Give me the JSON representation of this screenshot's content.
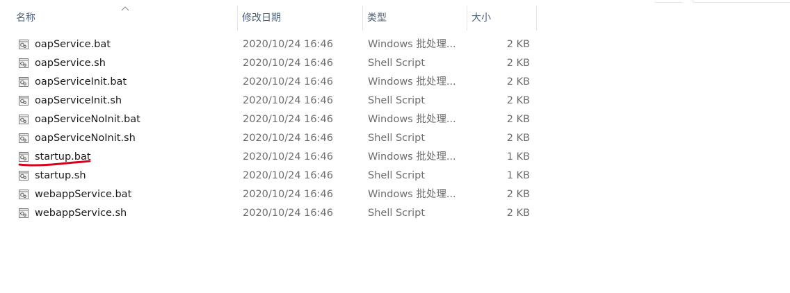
{
  "columns": {
    "name": "名称",
    "date": "修改日期",
    "type": "类型",
    "size": "大小"
  },
  "sort_indicator": "ascending",
  "files": [
    {
      "name": "oapService.bat",
      "date": "2020/10/24 16:46",
      "type": "Windows 批处理...",
      "size": "2 KB"
    },
    {
      "name": "oapService.sh",
      "date": "2020/10/24 16:46",
      "type": "Shell Script",
      "size": "2 KB"
    },
    {
      "name": "oapServiceInit.bat",
      "date": "2020/10/24 16:46",
      "type": "Windows 批处理...",
      "size": "2 KB"
    },
    {
      "name": "oapServiceInit.sh",
      "date": "2020/10/24 16:46",
      "type": "Shell Script",
      "size": "2 KB"
    },
    {
      "name": "oapServiceNoInit.bat",
      "date": "2020/10/24 16:46",
      "type": "Windows 批处理...",
      "size": "2 KB"
    },
    {
      "name": "oapServiceNoInit.sh",
      "date": "2020/10/24 16:46",
      "type": "Shell Script",
      "size": "2 KB"
    },
    {
      "name": "startup.bat",
      "date": "2020/10/24 16:46",
      "type": "Windows 批处理...",
      "size": "1 KB"
    },
    {
      "name": "startup.sh",
      "date": "2020/10/24 16:46",
      "type": "Shell Script",
      "size": "1 KB"
    },
    {
      "name": "webappService.bat",
      "date": "2020/10/24 16:46",
      "type": "Windows 批处理...",
      "size": "2 KB"
    },
    {
      "name": "webappService.sh",
      "date": "2020/10/24 16:46",
      "type": "Shell Script",
      "size": "2 KB"
    }
  ],
  "annotation_color": "#d9001b"
}
